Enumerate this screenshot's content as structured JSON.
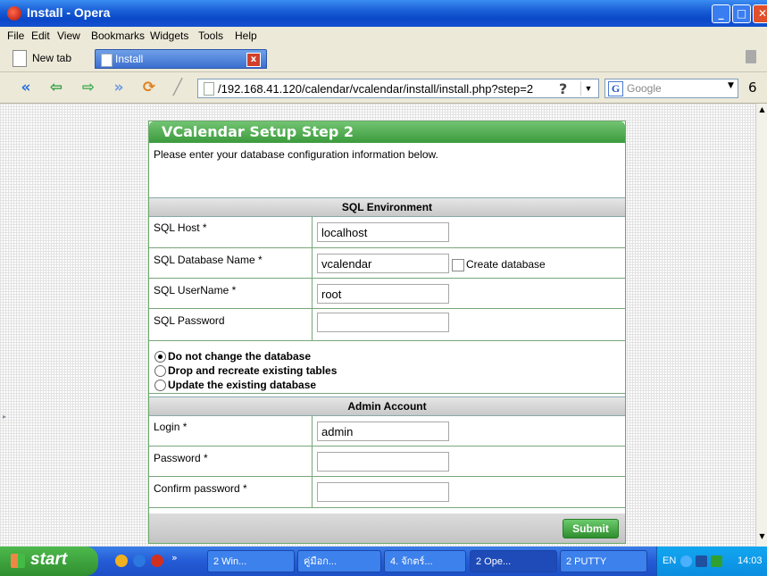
{
  "window": {
    "title": "Install - Opera"
  },
  "menu": [
    "File",
    "Edit",
    "View",
    "Bookmarks",
    "Widgets",
    "Tools",
    "Help"
  ],
  "tabs": {
    "new_tab": "New tab",
    "active": "Install"
  },
  "address": {
    "url": "/192.168.41.120/calendar/vcalendar/install/install.php?step=2"
  },
  "search": {
    "placeholder": "Google"
  },
  "form": {
    "title": "VCalendar Setup Step 2",
    "intro": "Please enter your database configuration information below.",
    "sql_section": "SQL Environment",
    "fields": {
      "host": {
        "label": "SQL Host *",
        "value": "localhost"
      },
      "dbname": {
        "label": "SQL Database Name *",
        "value": "vcalendar"
      },
      "user": {
        "label": "SQL UserName *",
        "value": "root"
      },
      "password": {
        "label": "SQL Password",
        "value": ""
      }
    },
    "create_db_label": "Create database",
    "radios": [
      {
        "label": "Do not change the database",
        "checked": true
      },
      {
        "label": "Drop and recreate existing tables",
        "checked": false
      },
      {
        "label": "Update the existing database",
        "checked": false
      }
    ],
    "admin_section": "Admin Account",
    "admin": {
      "login": {
        "label": "Login *",
        "value": "admin"
      },
      "password": {
        "label": "Password *",
        "value": ""
      },
      "confirm": {
        "label": "Confirm password *",
        "value": ""
      }
    },
    "submit": "Submit"
  },
  "taskbar": {
    "start": "start",
    "buttons": [
      "2 Win...",
      "คู่มือก...",
      "4. จักตร์...",
      "2 Ope...",
      "2 PUTTY"
    ],
    "lang": "EN",
    "clock": "14:03"
  }
}
